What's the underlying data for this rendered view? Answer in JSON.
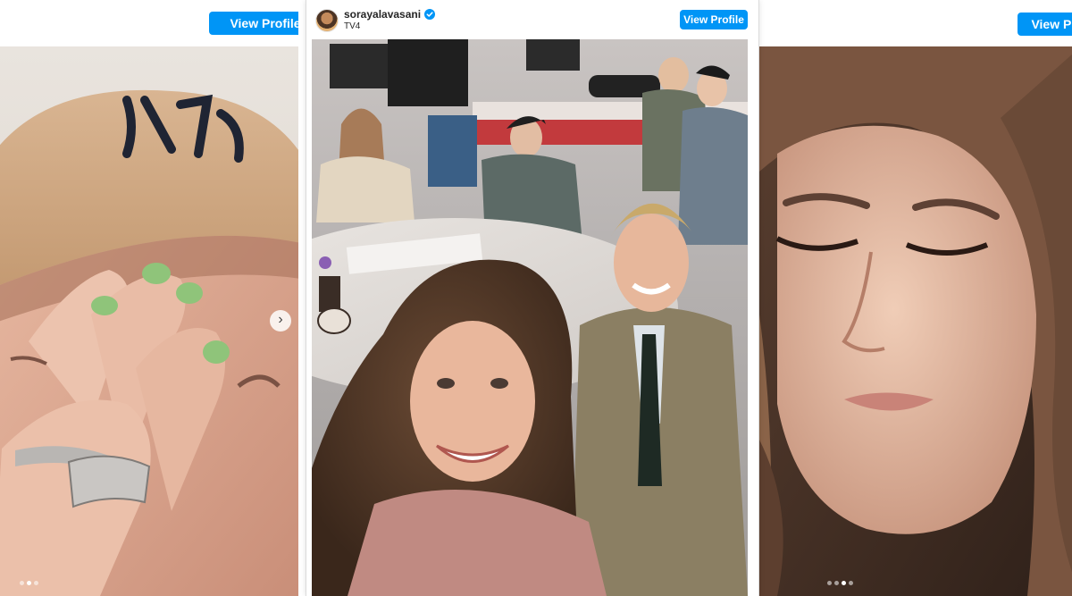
{
  "left_post": {
    "view_profile_label": "View Profile",
    "carousel": {
      "dot_count": 3,
      "active_index": 1
    }
  },
  "center_post": {
    "username": "sorayalavasani",
    "verified": true,
    "subtitle": "TV4",
    "view_profile_label": "View Profile"
  },
  "right_post": {
    "view_profile_label": "View Profile",
    "carousel": {
      "dot_count": 4,
      "active_index": 2
    }
  },
  "colors": {
    "button_blue": "#0095f6",
    "verified_blue": "#0095f6"
  }
}
